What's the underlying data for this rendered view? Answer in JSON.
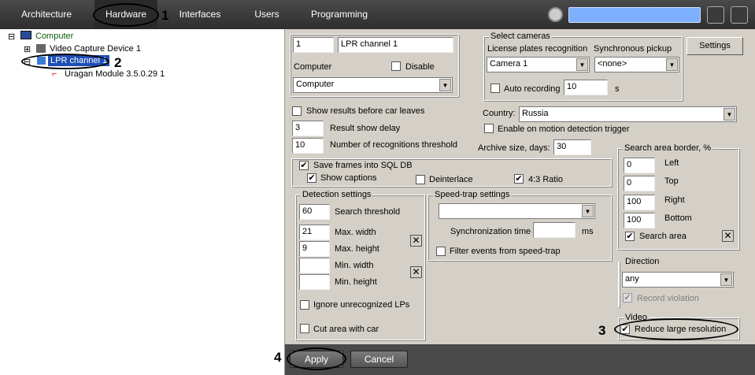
{
  "topbar": {
    "tabs": [
      "Architecture",
      "Hardware",
      "Interfaces",
      "Users",
      "Programming"
    ]
  },
  "annotations": [
    "1",
    "2",
    "3",
    "4"
  ],
  "tree": {
    "computer": "Computer",
    "video": "Video Capture Device 1",
    "lpr": "LPR channel 1",
    "uragan": "Uragan Module 3.5.0.29 1"
  },
  "main": {
    "id": "1",
    "name": "LPR channel 1",
    "computer_label": "Computer",
    "disable_label": "Disable",
    "computer_value": "Computer",
    "select_cameras": "Select cameras",
    "lpr_label": "License plates recognition",
    "sync_label": "Synchronous pickup",
    "camera_value": "Camera 1",
    "sync_value": "<none>",
    "auto_recording": "Auto recording",
    "auto_value": "10",
    "seconds": "s",
    "settings": "Settings",
    "show_results": "Show results before car leaves",
    "result_delay_value": "3",
    "result_delay": "Result show delay",
    "recog_value": "10",
    "recog_threshold": "Number of recognitions threshold",
    "country_label": "Country:",
    "country_value": "Russia",
    "motion": "Enable on motion detection trigger",
    "archive_label": "Archive size, days:",
    "archive_value": "30",
    "save_frames": "Save frames into SQL DB",
    "show_captions": "Show captions",
    "deinterlace": "Deinterlace",
    "ratio": "4:3 Ratio",
    "detection": "Detection settings",
    "search_threshold_value": "60",
    "search_threshold": "Search threshold",
    "max_width_value": "21",
    "max_width": "Max. width",
    "max_height_value": "9",
    "max_height": "Max. height",
    "min_width": "Min. width",
    "min_height": "Min. height",
    "ignore": "Ignore unrecognized LPs",
    "cut_area": "Cut area with car",
    "speedtrap": "Speed-trap settings",
    "sync_time": "Synchronization time",
    "ms": "ms",
    "filter": "Filter events from speed-trap",
    "border": "Search area border, %",
    "left_value": "0",
    "left": "Left",
    "top_value": "0",
    "top": "Top",
    "right_value": "100",
    "right": "Right",
    "bottom_value": "100",
    "bottom": "Bottom",
    "search_area": "Search area",
    "direction": "Direction",
    "direction_value": "any",
    "record_violation": "Record violation",
    "video": "Video",
    "reduce": "Reduce large resolution"
  },
  "footer": {
    "apply": "Apply",
    "cancel": "Cancel"
  }
}
